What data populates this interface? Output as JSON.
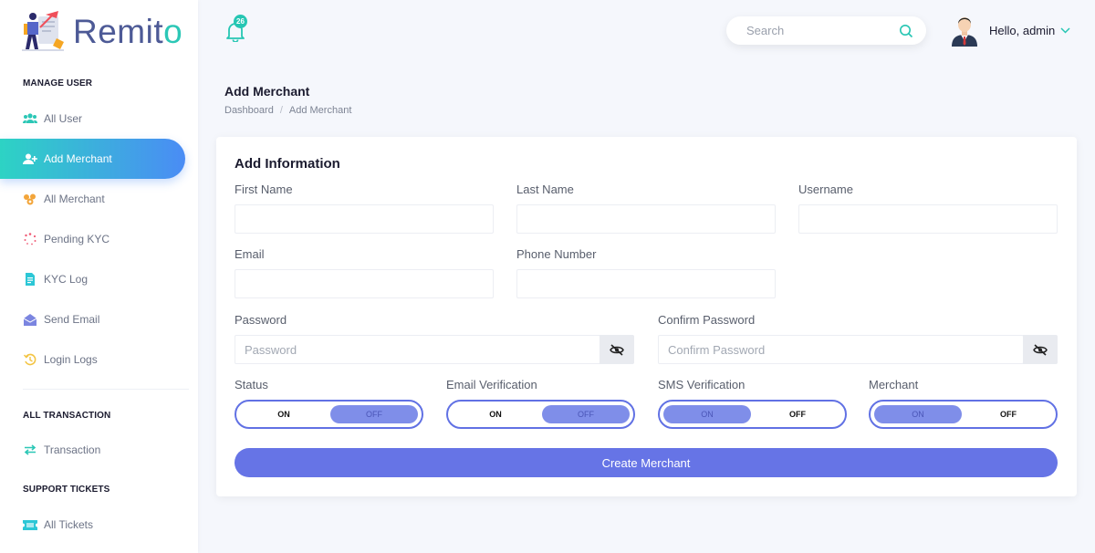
{
  "brand": {
    "name_main": "Remit",
    "name_accent": "o",
    "accent_color": "#2cc7b6",
    "primary_color": "#4d5a96"
  },
  "sidebar": {
    "sections": [
      {
        "title": "MANAGE USER"
      },
      {
        "title": "ALL TRANSACTION"
      },
      {
        "title": "SUPPORT TICKETS"
      }
    ],
    "items": [
      {
        "label": "All User",
        "icon": "users-icon",
        "active": false
      },
      {
        "label": "Add Merchant",
        "icon": "user-plus-icon",
        "active": true
      },
      {
        "label": "All Merchant",
        "icon": "merchants-icon",
        "active": false
      },
      {
        "label": "Pending KYC",
        "icon": "spinner-icon",
        "active": false
      },
      {
        "label": "KYC Log",
        "icon": "document-icon",
        "active": false
      },
      {
        "label": "Send Email",
        "icon": "envelope-open-icon",
        "active": false
      },
      {
        "label": "Login Logs",
        "icon": "history-icon",
        "active": false
      },
      {
        "label": "Transaction",
        "icon": "exchange-icon",
        "active": false
      },
      {
        "label": "All Tickets",
        "icon": "ticket-icon",
        "active": false
      }
    ]
  },
  "header": {
    "notifications_count": "26",
    "search": {
      "placeholder": "Search",
      "value": ""
    },
    "greeting": "Hello, admin"
  },
  "page": {
    "title": "Add Merchant",
    "breadcrumb": [
      "Dashboard",
      "Add Merchant"
    ]
  },
  "form": {
    "title": "Add Information",
    "fields": {
      "first_name": {
        "label": "First Name",
        "value": ""
      },
      "last_name": {
        "label": "Last Name",
        "value": ""
      },
      "username": {
        "label": "Username",
        "value": ""
      },
      "email": {
        "label": "Email",
        "value": ""
      },
      "phone": {
        "label": "Phone Number",
        "value": ""
      },
      "password": {
        "label": "Password",
        "placeholder": "Password",
        "value": ""
      },
      "confirm_password": {
        "label": "Confirm Password",
        "placeholder": "Confirm Password",
        "value": ""
      }
    },
    "toggles": [
      {
        "label": "Status",
        "on": "ON",
        "off": "OFF",
        "selected": "OFF"
      },
      {
        "label": "Email Verification",
        "on": "ON",
        "off": "OFF",
        "selected": "OFF"
      },
      {
        "label": "SMS Verification",
        "on": "ON",
        "off": "OFF",
        "selected": "ON"
      },
      {
        "label": "Merchant",
        "on": "ON",
        "off": "OFF",
        "selected": "ON"
      }
    ],
    "submit_label": "Create Merchant"
  }
}
